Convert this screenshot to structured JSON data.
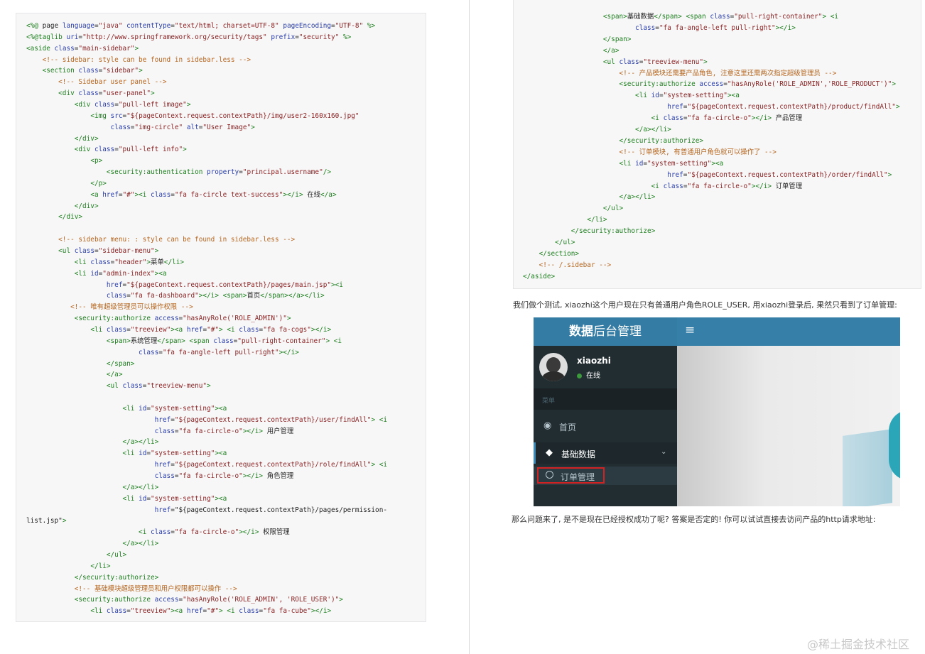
{
  "left_code": [
    "<%@ page language=\"java\" contentType=\"text/html; charset=UTF-8\" pageEncoding=\"UTF-8\" %>",
    "<%@taglib uri=\"http://www.springframework.org/security/tags\" prefix=\"security\" %>",
    "<aside class=\"main-sidebar\">",
    "    <!-- sidebar: style can be found in sidebar.less -->",
    "    <section class=\"sidebar\">",
    "        <!-- Sidebar user panel -->",
    "        <div class=\"user-panel\">",
    "            <div class=\"pull-left image\">",
    "                <img src=\"${pageContext.request.contextPath}/img/user2-160x160.jpg\"",
    "                     class=\"img-circle\" alt=\"User Image\">",
    "            </div>",
    "            <div class=\"pull-left info\">",
    "                <p>",
    "                    <security:authentication property=\"principal.username\"/>",
    "                </p>",
    "                <a href=\"#\"><i class=\"fa fa-circle text-success\"></i> 在线</a>",
    "            </div>",
    "        </div>",
    "",
    "        <!-- sidebar menu: : style can be found in sidebar.less -->",
    "        <ul class=\"sidebar-menu\">",
    "            <li class=\"header\">菜单</li>",
    "            <li id=\"admin-index\"><a",
    "                    href=\"${pageContext.request.contextPath}/pages/main.jsp\"><i",
    "                    class=\"fa fa-dashboard\"></i> <span>首页</span></a></li>",
    "           <!-- 唯有超级管理员可以操作权限 -->",
    "            <security:authorize access=\"hasAnyRole('ROLE_ADMIN')\">",
    "                <li class=\"treeview\"><a href=\"#\"> <i class=\"fa fa-cogs\"></i>",
    "                    <span>系统管理</span> <span class=\"pull-right-container\"> <i",
    "                            class=\"fa fa-angle-left pull-right\"></i>",
    "                    </span>",
    "                    </a>",
    "                    <ul class=\"treeview-menu\">",
    "",
    "                        <li id=\"system-setting\"><a",
    "                                href=\"${pageContext.request.contextPath}/user/findAll\"> <i",
    "                                class=\"fa fa-circle-o\"></i> 用户管理",
    "                        </a></li>",
    "                        <li id=\"system-setting\"><a",
    "                                href=\"${pageContext.request.contextPath}/role/findAll\"> <i",
    "                                class=\"fa fa-circle-o\"></i> 角色管理",
    "                        </a></li>",
    "                        <li id=\"system-setting\"><a",
    "                                href=\"${pageContext.request.contextPath}/pages/permission-",
    "list.jsp\">",
    "                            <i class=\"fa fa-circle-o\"></i> 权限管理",
    "                        </a></li>",
    "                    </ul>",
    "                </li>",
    "            </security:authorize>",
    "            <!-- 基础模块超级管理员和用户权限都可以操作 -->",
    "            <security:authorize access=\"hasAnyRole('ROLE_ADMIN', 'ROLE_USER')\">",
    "                <li class=\"treeview\"><a href=\"#\"> <i class=\"fa fa-cube\"></i>"
  ],
  "right_code": [
    "                    <span>基础数据</span> <span class=\"pull-right-container\"> <i",
    "                            class=\"fa fa-angle-left pull-right\"></i>",
    "                    </span>",
    "                    </a>",
    "                    <ul class=\"treeview-menu\">",
    "                        <!-- 产品模块还需要产品角色, 注意这里还需两次指定超级管理员 -->",
    "                        <security:authorize access=\"hasAnyRole('ROLE_ADMIN','ROLE_PRODUCT')\">",
    "                            <li id=\"system-setting\"><a",
    "                                    href=\"${pageContext.request.contextPath}/product/findAll\">",
    "                                <i class=\"fa fa-circle-o\"></i> 产品管理",
    "                            </a></li>",
    "                        </security:authorize>",
    "                        <!-- 订单模块, 有普通用户角色就可以操作了 -->",
    "                        <li id=\"system-setting\"><a",
    "                                    href=\"${pageContext.request.contextPath}/order/findAll\">",
    "                                <i class=\"fa fa-circle-o\"></i> 订单管理",
    "                        </a></li>",
    "                    </ul>",
    "                </li>",
    "            </security:authorize>",
    "        </ul>",
    "    </section>",
    "    <!-- /.sidebar -->",
    "</aside>"
  ],
  "paragraph1": "我们做个测试, xiaozhi这个用户现在只有普通用户角色ROLE_USER, 用xiaozhi登录后, 果然只看到了订单管理:",
  "paragraph2": "那么问题来了, 是不是现在已经授权成功了呢? 答案是否定的! 你可以试试直接去访问产品的http请求地址:",
  "embedded": {
    "logo_bold": "数据",
    "logo_rest": "后台管理",
    "hamburger_icon": "≡",
    "username": "xiaozhi",
    "status": "在线",
    "menu_header": "菜单",
    "home_label": "首页",
    "base_data_label": "基础数据",
    "order_label": "订单管理",
    "accent_color": "#3c8dbc",
    "highlight_color": "#d22222"
  },
  "watermark": "@稀土掘金技术社区"
}
